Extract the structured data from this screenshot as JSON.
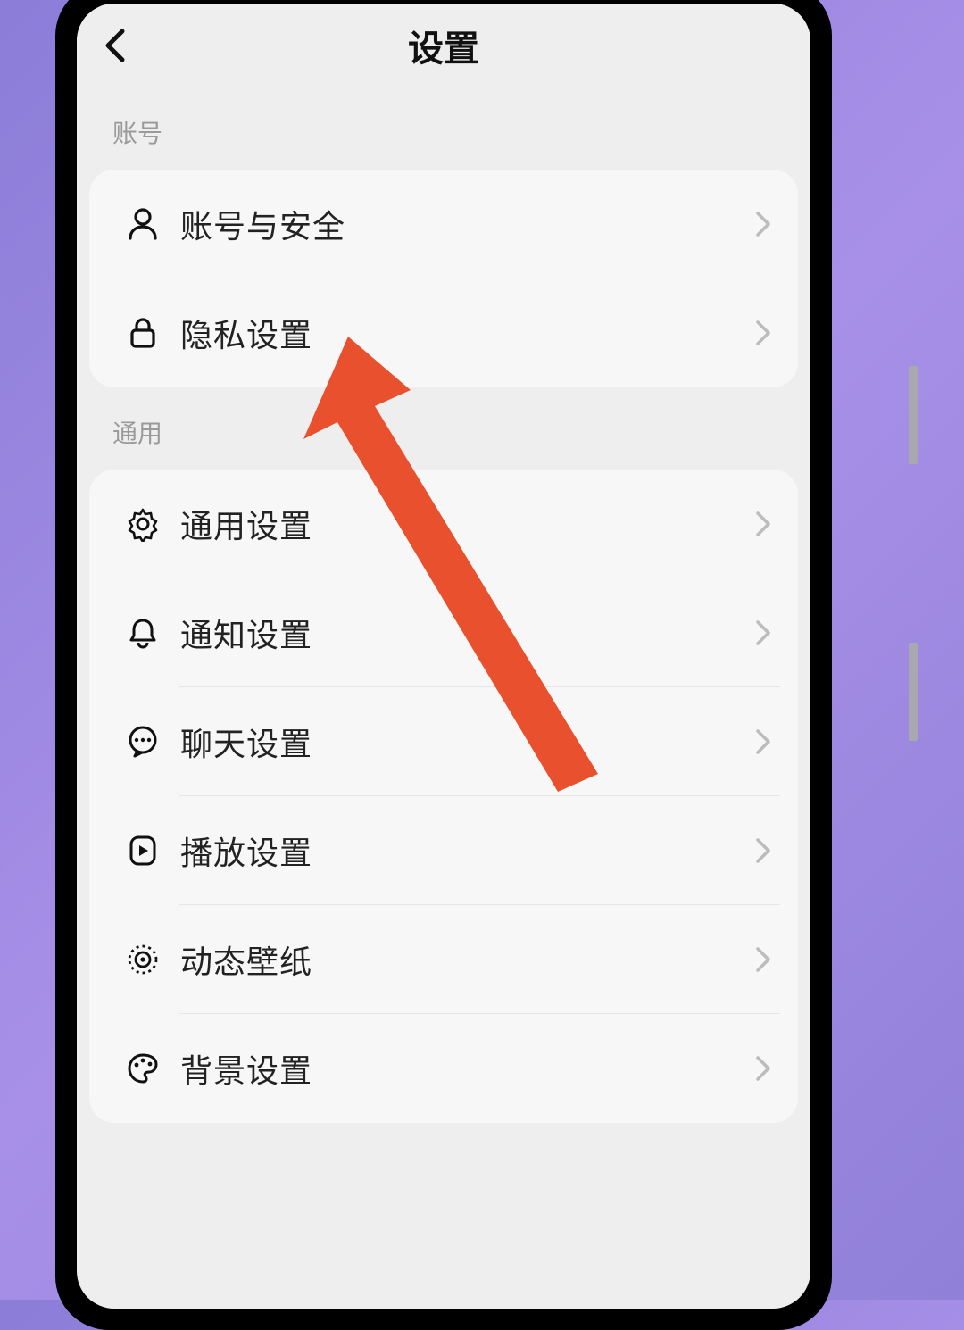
{
  "header": {
    "title": "设置"
  },
  "sections": {
    "account": {
      "label": "账号",
      "items": [
        {
          "label": "账号与安全",
          "icon": "person-icon"
        },
        {
          "label": "隐私设置",
          "icon": "lock-icon"
        }
      ]
    },
    "general": {
      "label": "通用",
      "items": [
        {
          "label": "通用设置",
          "icon": "gear-icon"
        },
        {
          "label": "通知设置",
          "icon": "bell-icon"
        },
        {
          "label": "聊天设置",
          "icon": "chat-icon"
        },
        {
          "label": "播放设置",
          "icon": "play-icon"
        },
        {
          "label": "动态壁纸",
          "icon": "wallpaper-icon"
        },
        {
          "label": "背景设置",
          "icon": "palette-icon"
        }
      ]
    }
  },
  "colors": {
    "annotation": "#e8502e"
  }
}
